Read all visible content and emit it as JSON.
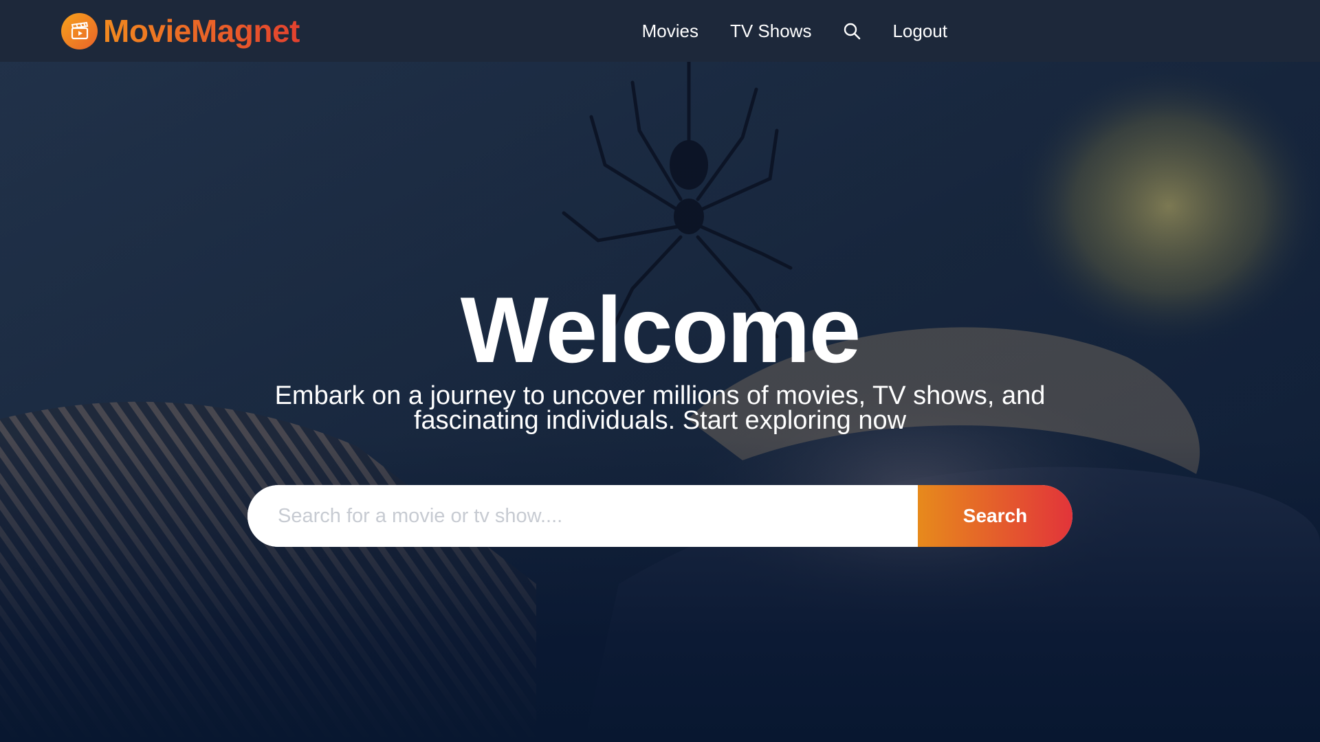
{
  "header": {
    "brand": "MovieMagnet",
    "nav": {
      "movies": "Movies",
      "tv_shows": "TV Shows",
      "logout": "Logout"
    }
  },
  "hero": {
    "title": "Welcome",
    "subtitle": "Embark on a journey to uncover millions of movies, TV shows, and fascinating individuals. Start exploring now",
    "search": {
      "placeholder": "Search for a movie or tv show....",
      "value": "",
      "button_label": "Search"
    }
  },
  "colors": {
    "header_bg": "#1d283a",
    "accent_start": "#e78a1c",
    "accent_end": "#e2343a",
    "hero_base": "#0b1a33"
  },
  "icons": {
    "logo": "clapperboard-play-icon",
    "nav_search": "search-icon"
  }
}
